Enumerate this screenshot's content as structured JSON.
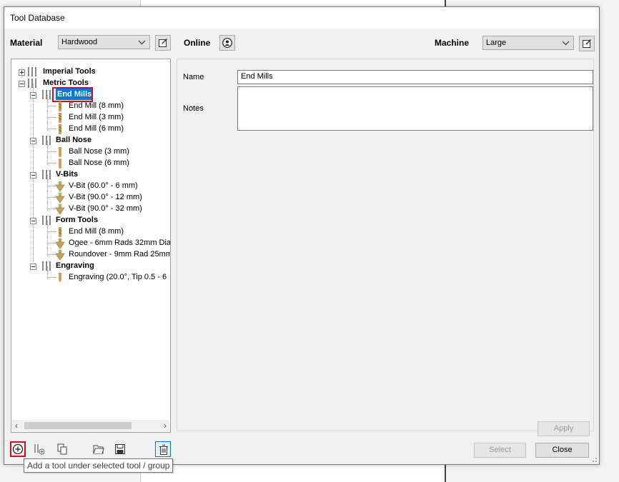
{
  "window": {
    "title": "Tool Database"
  },
  "top": {
    "material_label": "Material",
    "material_value": "Hardwood",
    "online_label": "Online",
    "machine_label": "Machine",
    "machine_value": "Large"
  },
  "tree": {
    "imperial": "Imperial Tools",
    "metric": "Metric Tools",
    "end_mills_group": "End Mills",
    "end_mills_items": [
      "End Mill (8 mm)",
      "End Mill (3 mm)",
      "End Mill (6 mm)"
    ],
    "ball_nose_group": "Ball Nose",
    "ball_nose_items": [
      "Ball Nose (3 mm)",
      "Ball Nose (6 mm)"
    ],
    "vbits_group": "V-Bits",
    "vbits_items": [
      "V-Bit (60.0° - 6 mm)",
      "V-Bit (90.0° - 12 mm)",
      "V-Bit (90.0° - 32 mm)"
    ],
    "form_group": "Form Tools",
    "form_items": [
      "End Mill (8 mm)",
      "Ogee - 6mm Rads 32mm Dia :",
      "Roundover -  9mm Rad 25mm"
    ],
    "engraving_group": "Engraving",
    "engraving_items": [
      "Engraving (20.0°, Tip 0.5 - 6"
    ]
  },
  "details": {
    "name_label": "Name",
    "name_value": "End Mills",
    "notes_label": "Notes",
    "notes_value": ""
  },
  "buttons": {
    "apply": "Apply",
    "select": "Select",
    "close": "Close"
  },
  "tooltip": {
    "text": "Add a tool under selected tool / group"
  },
  "icons": {
    "edit_material": "edit-icon",
    "online": "user-circle-icon",
    "edit_machine": "edit-icon",
    "add_tool": "add-circle-icon",
    "add_group": "add-group-icon",
    "copy": "copy-icon",
    "open": "folder-icon",
    "save": "save-icon",
    "delete": "trash-icon"
  },
  "colors": {
    "selection": "#0078d7",
    "highlight_box": "#c8102e",
    "tool_gold": "#c9a35a"
  }
}
